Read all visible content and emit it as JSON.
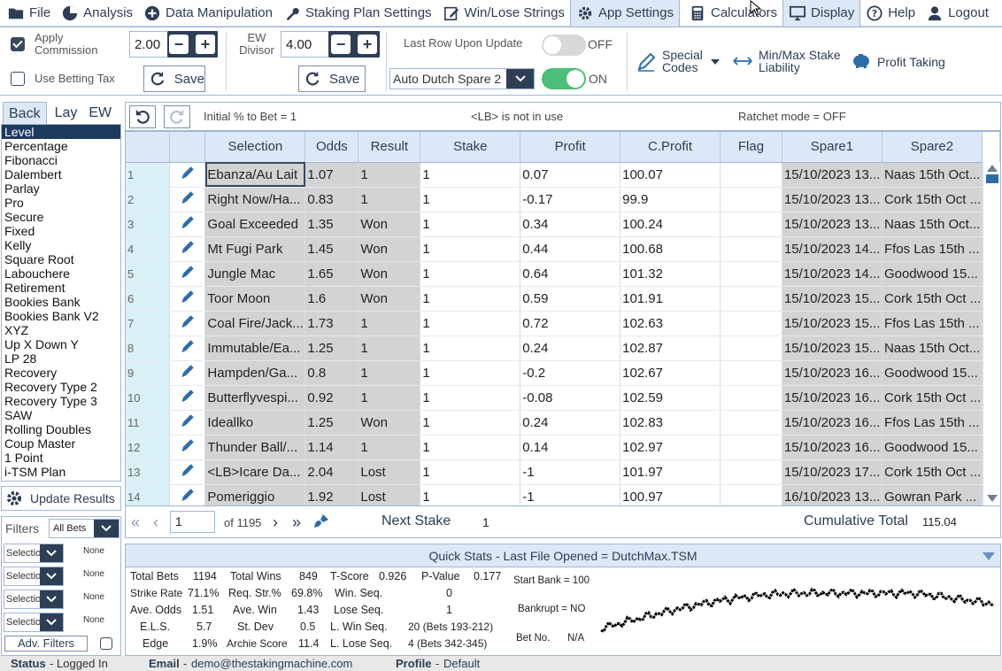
{
  "menu": [
    {
      "label": "File",
      "icon": "folder-icon"
    },
    {
      "label": "Analysis",
      "icon": "pie-chart-icon"
    },
    {
      "label": "Data Manipulation",
      "icon": "plus-circle-icon"
    },
    {
      "label": "Staking Plan Settings",
      "icon": "wrench-icon"
    },
    {
      "label": "Win/Lose Strings",
      "icon": "edit-icon"
    },
    {
      "label": "App Settings",
      "icon": "gear-icon"
    },
    {
      "label": "Calculators",
      "icon": "calculator-icon"
    },
    {
      "label": "Display",
      "icon": "monitor-icon"
    },
    {
      "label": "Help",
      "icon": "question-icon"
    },
    {
      "label": "Logout",
      "icon": "user-icon"
    }
  ],
  "toolbar": {
    "apply_commission_label": "Apply Commission",
    "apply_commission_value": "2.00",
    "use_betting_tax_label": "Use Betting Tax",
    "save_label": "Save",
    "ew_divisor_label": "EW Divisor",
    "ew_divisor_value": "4.00",
    "last_row_label": "Last Row Upon Update",
    "last_row_state": "OFF",
    "dutch_select": "Auto Dutch Spare 2",
    "dutch_state": "ON",
    "special_codes_label": "Special Codes",
    "minmax_label": "Min/Max Stake Liability",
    "profit_taking_label": "Profit Taking"
  },
  "tabs": [
    "Back",
    "Lay",
    "EW"
  ],
  "plans": [
    "Level",
    "Percentage",
    "Fibonacci",
    "Dalembert",
    "Parlay",
    "Pro",
    "Secure",
    "Fixed",
    "Kelly",
    "Square Root",
    "Labouchere",
    "Retirement",
    "Bookies Bank",
    "Bookies Bank V2",
    "XYZ",
    "Up X Down Y",
    "LP 28",
    "Recovery",
    "Recovery Type 2",
    "Recovery Type 3",
    "SAW",
    "Rolling Doubles",
    "Coup Master",
    "1 Point",
    "i-TSM Plan"
  ],
  "update_results_label": "Update Results",
  "filters": {
    "label": "Filters",
    "all_bets": "All Bets",
    "rows": [
      {
        "select": "Selection",
        "value": "None"
      },
      {
        "select": "Selection",
        "value": "None"
      },
      {
        "select": "Selection",
        "value": "None"
      },
      {
        "select": "Selection",
        "value": "None"
      }
    ],
    "adv_label": "Adv. Filters"
  },
  "grid_info": {
    "initial": "Initial % to Bet = 1",
    "lb": "<LB> is not in use",
    "ratchet": "Ratchet mode = OFF"
  },
  "columns": [
    "Selection",
    "Odds",
    "Result",
    "Stake",
    "Profit",
    "C.Profit",
    "Flag",
    "Spare1",
    "Spare2"
  ],
  "rows": [
    {
      "n": "1",
      "selection": "Ebanza/Au Lait",
      "odds": "1.07",
      "result": "1",
      "stake": "1",
      "profit": "0.07",
      "cprofit": "100.07",
      "flag": "",
      "spare1": "15/10/2023 13...",
      "spare2": "Naas 15th Oct..."
    },
    {
      "n": "2",
      "selection": "Right Now/Ha...",
      "odds": "0.83",
      "result": "1",
      "stake": "1",
      "profit": "-0.17",
      "cprofit": "99.9",
      "flag": "",
      "spare1": "15/10/2023 13...",
      "spare2": "Cork 15th Oct ..."
    },
    {
      "n": "3",
      "selection": "Goal Exceeded",
      "odds": "1.35",
      "result": "Won",
      "stake": "1",
      "profit": "0.34",
      "cprofit": "100.24",
      "flag": "",
      "spare1": "15/10/2023 13...",
      "spare2": "Naas 15th Oct..."
    },
    {
      "n": "4",
      "selection": "Mt Fugi Park",
      "odds": "1.45",
      "result": "Won",
      "stake": "1",
      "profit": "0.44",
      "cprofit": "100.68",
      "flag": "",
      "spare1": "15/10/2023 14...",
      "spare2": "Ffos Las 15th ..."
    },
    {
      "n": "5",
      "selection": "Jungle Mac",
      "odds": "1.65",
      "result": "Won",
      "stake": "1",
      "profit": "0.64",
      "cprofit": "101.32",
      "flag": "",
      "spare1": "15/10/2023 14...",
      "spare2": "Goodwood 15..."
    },
    {
      "n": "6",
      "selection": "Toor Moon",
      "odds": "1.6",
      "result": "Won",
      "stake": "1",
      "profit": "0.59",
      "cprofit": "101.91",
      "flag": "",
      "spare1": "15/10/2023 15...",
      "spare2": "Cork 15th Oct ..."
    },
    {
      "n": "7",
      "selection": "Coal Fire/Jack...",
      "odds": "1.73",
      "result": "1",
      "stake": "1",
      "profit": "0.72",
      "cprofit": "102.63",
      "flag": "",
      "spare1": "15/10/2023 15...",
      "spare2": "Ffos Las 15th ..."
    },
    {
      "n": "8",
      "selection": "Immutable/Ea...",
      "odds": "1.25",
      "result": "1",
      "stake": "1",
      "profit": "0.24",
      "cprofit": "102.87",
      "flag": "",
      "spare1": "15/10/2023 15...",
      "spare2": "Naas 15th Oct..."
    },
    {
      "n": "9",
      "selection": "Hampden/Ga...",
      "odds": "0.8",
      "result": "1",
      "stake": "1",
      "profit": "-0.2",
      "cprofit": "102.67",
      "flag": "",
      "spare1": "15/10/2023 16...",
      "spare2": "Goodwood 15..."
    },
    {
      "n": "10",
      "selection": "Butterflyvespi...",
      "odds": "0.92",
      "result": "1",
      "stake": "1",
      "profit": "-0.08",
      "cprofit": "102.59",
      "flag": "",
      "spare1": "15/10/2023 16...",
      "spare2": "Cork 15th Oct ..."
    },
    {
      "n": "11",
      "selection": "Ideallko",
      "odds": "1.25",
      "result": "Won",
      "stake": "1",
      "profit": "0.24",
      "cprofit": "102.83",
      "flag": "",
      "spare1": "15/10/2023 16...",
      "spare2": "Ffos Las 15th ..."
    },
    {
      "n": "12",
      "selection": "Thunder Ball/...",
      "odds": "1.14",
      "result": "1",
      "stake": "1",
      "profit": "0.14",
      "cprofit": "102.97",
      "flag": "",
      "spare1": "15/10/2023 16...",
      "spare2": "Goodwood 15..."
    },
    {
      "n": "13",
      "selection": "<LB>Icare Da...",
      "odds": "2.04",
      "result": "Lost",
      "stake": "1",
      "profit": "-1",
      "cprofit": "101.97",
      "flag": "",
      "spare1": "15/10/2023 17...",
      "spare2": "Cork 15th Oct ..."
    },
    {
      "n": "14",
      "selection": "Pomeriggio",
      "odds": "1.92",
      "result": "Lost",
      "stake": "1",
      "profit": "-1",
      "cprofit": "100.97",
      "flag": "",
      "spare1": "16/10/2023 13...",
      "spare2": "Gowran Park ..."
    }
  ],
  "pager": {
    "page": "1",
    "of": "of 1195",
    "next_stake_label": "Next Stake",
    "next_stake_value": "1",
    "cum_label": "Cumulative Total",
    "cum_value": "115.04"
  },
  "quickstats": {
    "header": "Quick Stats - Last File Opened = DutchMax.TSM",
    "total_bets_label": "Total Bets",
    "total_bets": "1194",
    "total_wins_label": "Total Wins",
    "total_wins": "849",
    "tscore_label": "T-Score",
    "tscore": "0.926",
    "pvalue_label": "P-Value",
    "pvalue": "0.177",
    "strike_label": "Strike Rate",
    "strike": "71.1%",
    "reqstr_label": "Req. Str.%",
    "reqstr": "69.8%",
    "winseq_label": "Win. Seq.",
    "winseq": "0",
    "aveodds_label": "Ave. Odds",
    "aveodds": "1.51",
    "avewin_label": "Ave. Win",
    "avewin": "1.43",
    "loseseq_label": "Lose Seq.",
    "loseseq": "1",
    "els_label": "E.L.S.",
    "els": "5.7",
    "stdev_label": "St. Dev",
    "stdev": "0.5",
    "lwinseq_label": "L. Win Seq.",
    "lwinseq": "20 (Bets 193-212)",
    "edge_label": "Edge",
    "edge": "1.9%",
    "archie_label": "Archie Score",
    "archie": "11.4",
    "llose_label": "L. Lose Seq.",
    "llose": "4 (Bets 342-345)",
    "start_bank": "Start Bank = 100",
    "bankrupt": "Bankrupt = NO",
    "betno_label": "Bet No.",
    "betno": "N/A"
  },
  "status": {
    "status_label": "Status",
    "status_value": "Logged In",
    "email_label": "Email",
    "email_value": "demo@thestakingmachine.com",
    "profile_label": "Profile",
    "profile_value": "Default"
  },
  "colors": {
    "accent": "#2e3e55",
    "header_bg": "#dce8f6",
    "toggle_on": "#4cbf7a"
  }
}
